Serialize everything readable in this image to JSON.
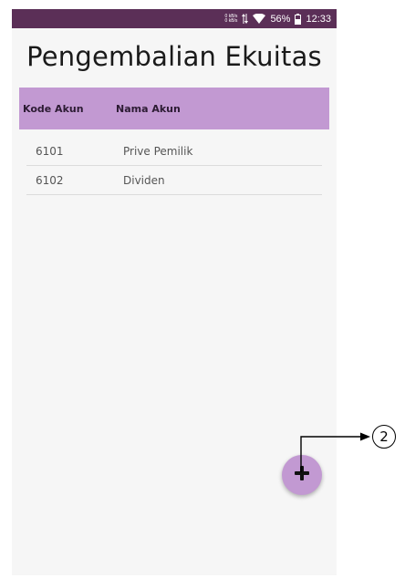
{
  "status_bar": {
    "net_speed_up": "0 kB/s",
    "net_speed_down": "0 kB/s",
    "battery": "56%",
    "time": "12:33"
  },
  "page": {
    "title": "Pengembalian Ekuitas"
  },
  "table": {
    "headers": {
      "code": "Kode Akun",
      "name": "Nama Akun"
    },
    "rows": [
      {
        "code": "6101",
        "name": "Prive Pemilik"
      },
      {
        "code": "6102",
        "name": "Dividen"
      }
    ]
  },
  "fab": {
    "icon": "plus-icon"
  },
  "annotation": {
    "label": "2"
  },
  "colors": {
    "status_bar": "#5b2f57",
    "header_bg": "#c299d2",
    "fab_bg": "#c299d2"
  }
}
